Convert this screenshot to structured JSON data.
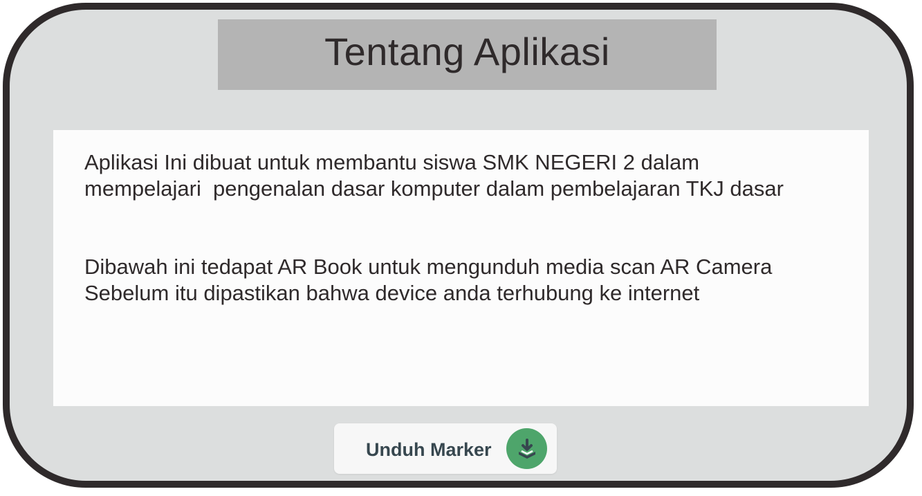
{
  "header": {
    "title": "Tentang Aplikasi"
  },
  "content": {
    "paragraph_1": {
      "line_1": "Aplikasi Ini dibuat untuk membantu siswa SMK NEGERI 2 dalam",
      "line_2": "mempelajari  pengenalan dasar komputer dalam pembelajaran TKJ dasar"
    },
    "paragraph_2": {
      "line_1": "Dibawah ini tedapat AR Book untuk mengunduh media scan AR Camera",
      "line_2": "Sebelum itu dipastikan bahwa device anda terhubung ke internet"
    }
  },
  "download_button": {
    "label": "Unduh Marker",
    "icon": "download-tray-icon"
  },
  "colors": {
    "frame_border": "#2f2a2b",
    "frame_background": "#dcdede",
    "title_background": "#b4b4b4",
    "panel_background": "#fcfcfc",
    "text": "#2f2a2b",
    "button_label": "#37474f",
    "button_icon_background": "#4ea56b"
  }
}
